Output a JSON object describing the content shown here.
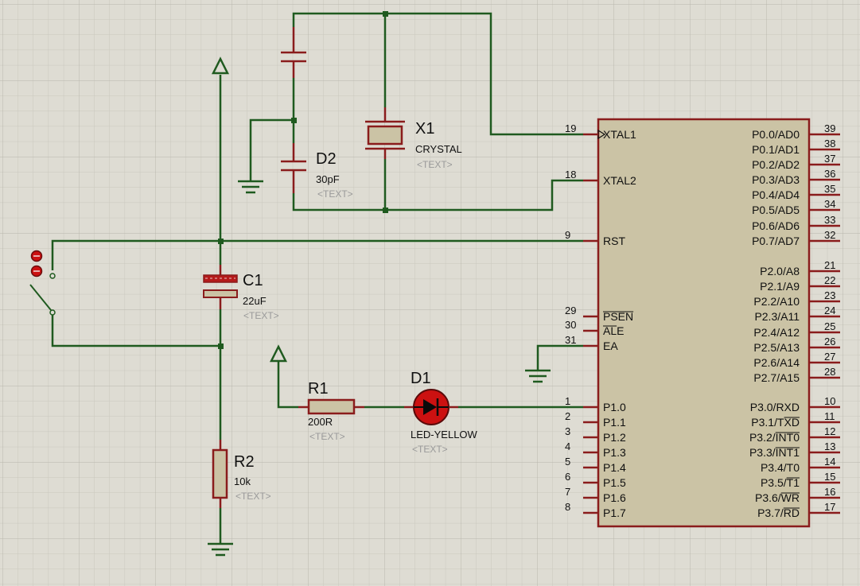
{
  "components": {
    "x1": {
      "ref": "X1",
      "value": "CRYSTAL",
      "text": "<TEXT>"
    },
    "d2": {
      "ref": "D2",
      "value": "30pF",
      "text": "<TEXT>"
    },
    "c1": {
      "ref": "C1",
      "value": "22uF",
      "text": "<TEXT>"
    },
    "r1": {
      "ref": "R1",
      "value": "200R",
      "text": "<TEXT>"
    },
    "r2": {
      "ref": "R2",
      "value": "10k",
      "text": "<TEXT>"
    },
    "d1": {
      "ref": "D1",
      "value": "LED-YELLOW",
      "text": "<TEXT>"
    }
  },
  "mcu": {
    "left_pins": [
      {
        "num": "19",
        "name": "XTAL1"
      },
      {
        "num": "18",
        "name": "XTAL2"
      },
      {
        "num": "9",
        "name": "RST"
      },
      {
        "num": "29",
        "name": "PSEN"
      },
      {
        "num": "30",
        "name": "ALE"
      },
      {
        "num": "31",
        "name": "EA"
      },
      {
        "num": "1",
        "name": "P1.0"
      },
      {
        "num": "2",
        "name": "P1.1"
      },
      {
        "num": "3",
        "name": "P1.2"
      },
      {
        "num": "4",
        "name": "P1.3"
      },
      {
        "num": "5",
        "name": "P1.4"
      },
      {
        "num": "6",
        "name": "P1.5"
      },
      {
        "num": "7",
        "name": "P1.6"
      },
      {
        "num": "8",
        "name": "P1.7"
      }
    ],
    "right_pins": [
      {
        "num": "39",
        "name": "P0.0/AD0"
      },
      {
        "num": "38",
        "name": "P0.1/AD1"
      },
      {
        "num": "37",
        "name": "P0.2/AD2"
      },
      {
        "num": "36",
        "name": "P0.3/AD3"
      },
      {
        "num": "35",
        "name": "P0.4/AD4"
      },
      {
        "num": "34",
        "name": "P0.5/AD5"
      },
      {
        "num": "33",
        "name": "P0.6/AD6"
      },
      {
        "num": "32",
        "name": "P0.7/AD7"
      },
      {
        "num": "21",
        "name": "P2.0/A8"
      },
      {
        "num": "22",
        "name": "P2.1/A9"
      },
      {
        "num": "23",
        "name": "P2.2/A10"
      },
      {
        "num": "24",
        "name": "P2.3/A11"
      },
      {
        "num": "25",
        "name": "P2.4/A12"
      },
      {
        "num": "26",
        "name": "P2.5/A13"
      },
      {
        "num": "27",
        "name": "P2.6/A14"
      },
      {
        "num": "28",
        "name": "P2.7/A15"
      },
      {
        "num": "10",
        "name": "P3.0/RXD"
      },
      {
        "num": "11",
        "name": "P3.1/TXD"
      },
      {
        "num": "12",
        "name": "P3.2/INT0"
      },
      {
        "num": "13",
        "name": "P3.3/INT1"
      },
      {
        "num": "14",
        "name": "P3.4/T0"
      },
      {
        "num": "15",
        "name": "P3.5/T1"
      },
      {
        "num": "16",
        "name": "P3.6/WR"
      },
      {
        "num": "17",
        "name": "P3.7/RD"
      }
    ]
  },
  "colors": {
    "background": "#dedcd3",
    "grid_minor": "#c9c7be",
    "grid_major": "#b8b6ad",
    "wire": "#1f5a1f",
    "component_outline": "#8a1c1c",
    "component_fill": "#cbc3a5",
    "led_body": "#cc1111"
  }
}
